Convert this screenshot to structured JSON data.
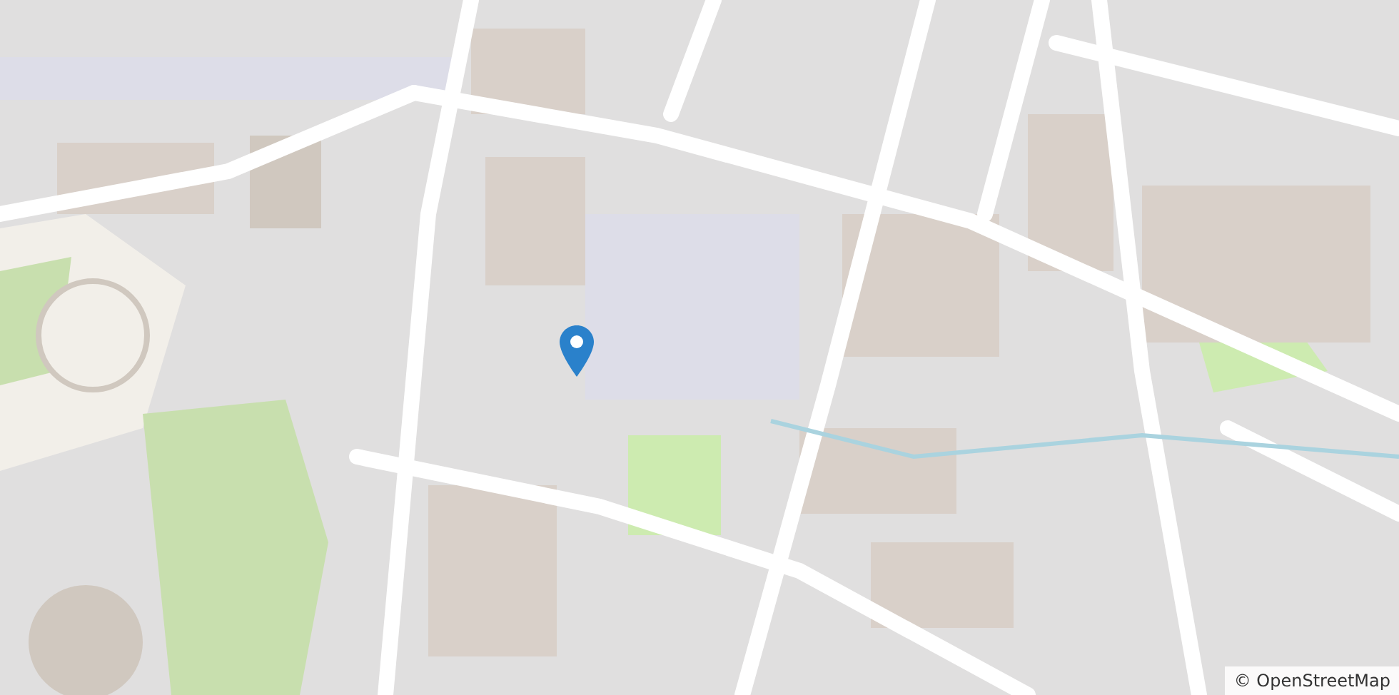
{
  "map": {
    "attribution": "© OpenStreetMap"
  }
}
